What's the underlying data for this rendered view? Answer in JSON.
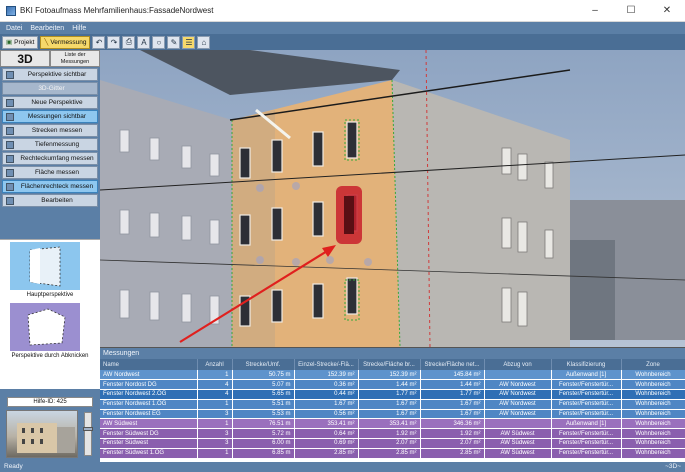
{
  "window": {
    "title": "BKI Fotoaufmass Mehrfamilienhaus:FassadeNordwest",
    "min": "–",
    "max": "☐",
    "close": "✕"
  },
  "menu": [
    "Datei",
    "Bearbeiten",
    "Hilfe"
  ],
  "toolbar": {
    "projekt": "Projekt",
    "vermessung": "Vermessung"
  },
  "left": {
    "btn_3d": "3D",
    "btn_liste": "Liste der Messungen",
    "rows": [
      {
        "label": "Perspektive sichtbar",
        "style": "normal"
      },
      {
        "label": "3D-Gitter",
        "style": "muted"
      },
      {
        "label": "Neue Perspektive",
        "style": "normal"
      },
      {
        "label": "Messungen sichtbar",
        "style": "sel"
      },
      {
        "label": "Strecken messen",
        "style": "normal"
      },
      {
        "label": "Tiefenmessung",
        "style": "normal"
      },
      {
        "label": "Rechteckumfang messen",
        "style": "normal"
      },
      {
        "label": "Fläche messen",
        "style": "normal"
      },
      {
        "label": "Flächenrechteck messen",
        "style": "sel"
      },
      {
        "label": "Bearbeiten",
        "style": "normal"
      }
    ],
    "thumb1_caption": "Hauptperspektive",
    "thumb2_caption": "Perspektive durch Abknicken",
    "hilfe": "Hilfe-ID: 425"
  },
  "table": {
    "title": "Messungen",
    "columns": [
      "Name",
      "Anzahl",
      "Strecke/Umf.",
      "Einzel-Strecke/-Flä...",
      "Strecke/Fläche br...",
      "Strecke/Fläche net...",
      "Abzug von",
      "Klassifizierung",
      "Zone"
    ],
    "rows": [
      {
        "kind": "head-blue",
        "cells": [
          "AW Nordwest",
          "1",
          "50.75 m",
          "152.39 m²",
          "152.39 m²",
          "145.84 m²",
          "",
          "Außenwand [1]",
          "Wohnbereich"
        ]
      },
      {
        "kind": "blue",
        "cells": [
          "Fenster Nordost DG",
          "4",
          "5.07 m",
          "0.36 m²",
          "1.44 m²",
          "1.44 m²",
          "AW Nordwest",
          "Fenster/Fenstertür...",
          "Wohnbereich"
        ]
      },
      {
        "kind": "blue selrow",
        "cells": [
          "Fenster Nordwest 2.OG",
          "4",
          "5.65 m",
          "0.44 m²",
          "1.77 m²",
          "1.77 m²",
          "AW Nordwest",
          "Fenster/Fenstertür...",
          "Wohnbereich"
        ]
      },
      {
        "kind": "blue",
        "cells": [
          "Fenster Nordwest 1.OG",
          "1",
          "5.51 m",
          "1.67 m²",
          "1.67 m²",
          "1.67 m²",
          "AW Nordwest",
          "Fenster/Fenstertür...",
          "Wohnbereich"
        ]
      },
      {
        "kind": "blue",
        "cells": [
          "Fenster Nordwest EG",
          "3",
          "5.53 m",
          "0.56 m²",
          "1.67 m²",
          "1.67 m²",
          "AW Nordwest",
          "Fenster/Fenstertür...",
          "Wohnbereich"
        ]
      },
      {
        "kind": "head-purple",
        "cells": [
          "AW Südwest",
          "1",
          "76.51 m",
          "353.41 m²",
          "353.41 m²",
          "346.36 m²",
          "",
          "Außenwand [1]",
          "Wohnbereich"
        ]
      },
      {
        "kind": "purple",
        "cells": [
          "Fenster Südwest DG",
          "3",
          "5.72 m",
          "0.64 m²",
          "1.92 m²",
          "1.92 m²",
          "AW Südwest",
          "Fenster/Fenstertür...",
          "Wohnbereich"
        ]
      },
      {
        "kind": "purple",
        "cells": [
          "Fenster Südwest",
          "3",
          "6.00 m",
          "0.69 m²",
          "2.07 m²",
          "2.07 m²",
          "AW Südwest",
          "Fenster/Fenstertür...",
          "Wohnbereich"
        ]
      },
      {
        "kind": "purple",
        "cells": [
          "Fenster Südwest 1.OG",
          "1",
          "6.85 m",
          "2.85 m²",
          "2.85 m²",
          "2.85 m²",
          "AW Südwest",
          "Fenster/Fenstertür...",
          "Wohnbereich"
        ]
      }
    ]
  },
  "status": {
    "left": "Ready",
    "right": "~3D~"
  }
}
